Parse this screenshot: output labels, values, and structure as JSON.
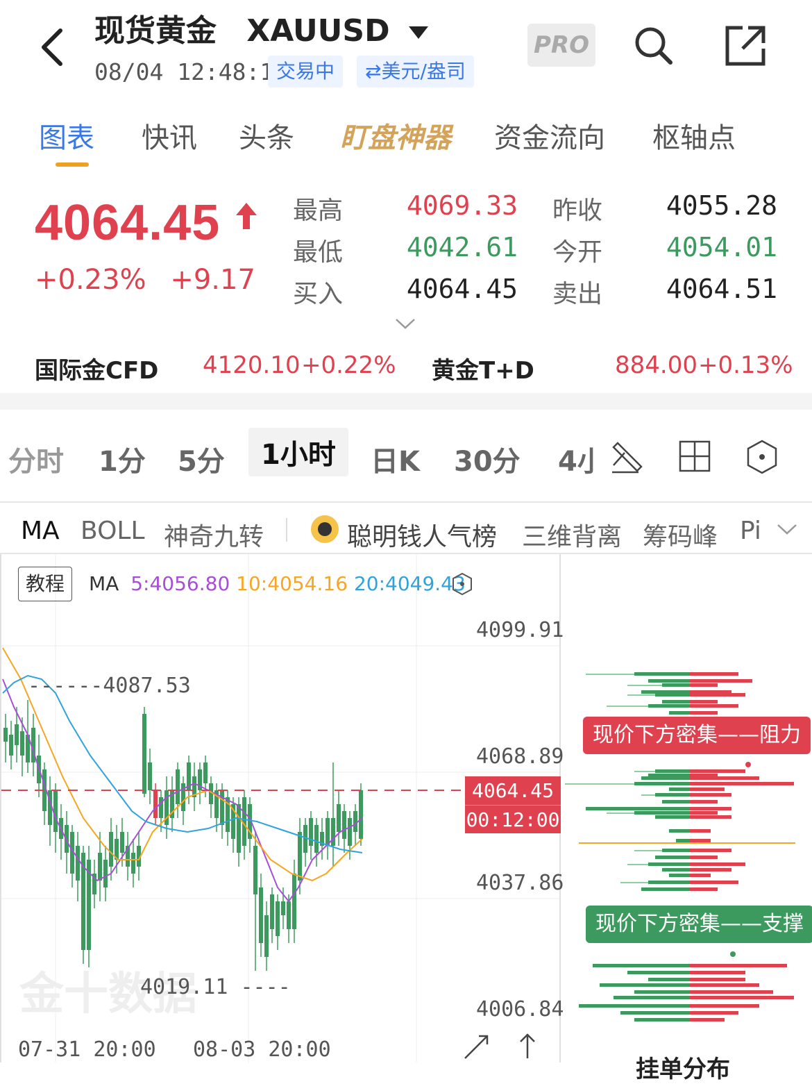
{
  "header": {
    "title": "现货黄金",
    "symbol": "XAUUSD",
    "timestamp": "08/04 12:48:12",
    "status_badge": "交易中",
    "unit_switch": "⇄美元/盎司",
    "pro_label": "PRO"
  },
  "tabs": [
    {
      "label": "图表",
      "active": true
    },
    {
      "label": "快讯"
    },
    {
      "label": "头条"
    },
    {
      "label": "盯盘神器"
    },
    {
      "label": "资金流向"
    },
    {
      "label": "枢轴点"
    }
  ],
  "quote": {
    "price": "4064.45",
    "direction": "up",
    "change_percent": "+0.23%",
    "change_value": "+9.17",
    "high_label": "最高",
    "high": "4069.33",
    "low_label": "最低",
    "low": "4042.61",
    "bid_label": "买入",
    "bid": "4064.45",
    "prev_close_label": "昨收",
    "prev_close": "4055.28",
    "open_label": "今开",
    "open": "4054.01",
    "ask_label": "卖出",
    "ask": "4064.51"
  },
  "related": [
    {
      "name": "国际金CFD",
      "price": "4120.10",
      "change": "+0.22%"
    },
    {
      "name": "黄金T+D",
      "price": "884.00",
      "change": "+0.13%"
    }
  ],
  "timeframes": [
    "分时",
    "1分",
    "5分",
    "1小时",
    "日K",
    "30分",
    "4小"
  ],
  "active_timeframe": "1小时",
  "indicators": [
    "MA",
    "BOLL",
    "神奇九转",
    "聪明钱人气榜",
    "三维背离",
    "筹码峰",
    "Pi"
  ],
  "chart": {
    "tutorial": "教程",
    "ma_label": "MA",
    "ma5": "5:4056.80",
    "ma10": "10:4054.16",
    "ma20": "20:4049.43",
    "y_labels": [
      "4099.91",
      "4068.89",
      "4037.86",
      "4006.84"
    ],
    "x_labels": [
      "07-31 20:00",
      "08-03 20:00"
    ],
    "high_marker": "4087.53",
    "low_marker": "4019.11",
    "current_price": "4064.45",
    "countdown": "00:12:00",
    "watermark": "金十数据",
    "colors": {
      "up": "#e0414f",
      "down": "#3c9a5f",
      "ma5": "#a64fd6",
      "ma10": "#f5a623",
      "ma20": "#2fa3dc"
    }
  },
  "orderbook": {
    "resistance_label": "现价下方密集——阻力",
    "support_label": "现价下方密集——支撑",
    "footer": "挂单分布"
  }
}
